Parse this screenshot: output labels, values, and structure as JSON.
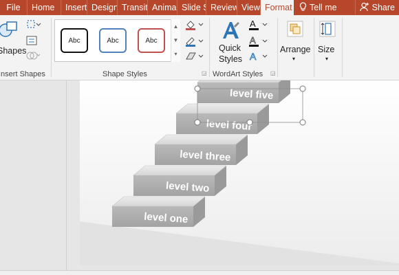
{
  "tabs": {
    "file": "File",
    "home": "Home",
    "insert": "Insert",
    "design": "Design",
    "transitions": "Transit",
    "animations": "Anima",
    "slideshow": "Slide S",
    "review": "Review",
    "view": "View",
    "format": "Format",
    "tellme": "Tell me",
    "share": "Share"
  },
  "ribbon": {
    "insert_shapes": {
      "shapes_label": "Shapes",
      "group_label": "Insert Shapes"
    },
    "shape_styles": {
      "style_text": "Abc",
      "group_label": "Shape Styles",
      "styles": [
        {
          "border": "#111111"
        },
        {
          "border": "#4f81bd"
        },
        {
          "border": "#c0504d"
        }
      ]
    },
    "wordart": {
      "quick_styles_line1": "Quick",
      "quick_styles_line2": "Styles",
      "group_label": "WordArt Styles"
    },
    "arrange": {
      "label": "Arrange"
    },
    "size": {
      "label": "Size"
    }
  },
  "colors": {
    "accent": "#b7472a",
    "ribbon": "#f3f3f3",
    "workspace": "#e6e6e6"
  },
  "slide": {
    "steps": [
      "level one",
      "level two",
      "level three",
      "level four",
      "level five"
    ]
  }
}
